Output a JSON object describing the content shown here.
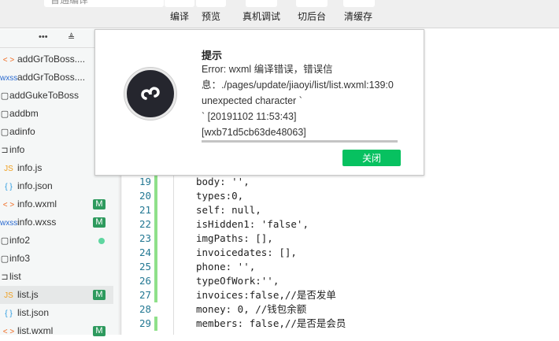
{
  "toolbar": {
    "compile_mode": "普通编译",
    "buttons": [
      "编译",
      "预览",
      "真机调试",
      "切后台",
      "清缓存"
    ]
  },
  "sidebar": {
    "more": "•••",
    "collapse": "≜",
    "items": [
      {
        "icon": "< >",
        "name": "addGrToBoss....",
        "badge": ""
      },
      {
        "icon": "wxss",
        "name": "addGrToBoss....",
        "badge": ""
      },
      {
        "icon": "folder",
        "name": "addGukeToBoss",
        "badge": ""
      },
      {
        "icon": "folder",
        "name": "addbm",
        "badge": ""
      },
      {
        "icon": "folder",
        "name": "adinfo",
        "badge": ""
      },
      {
        "icon": "folder-open",
        "name": "info",
        "badge": ""
      },
      {
        "icon": "JS",
        "name": "info.js",
        "badge": ""
      },
      {
        "icon": "{ }",
        "name": "info.json",
        "badge": ""
      },
      {
        "icon": "< >",
        "name": "info.wxml",
        "badge": "M"
      },
      {
        "icon": "wxss",
        "name": "info.wxss",
        "badge": "M"
      },
      {
        "icon": "folder",
        "name": "info2",
        "badge": "dot"
      },
      {
        "icon": "folder",
        "name": "info3",
        "badge": ""
      },
      {
        "icon": "folder-open",
        "name": "list",
        "badge": ""
      },
      {
        "icon": "JS",
        "name": "list.js",
        "badge": "M"
      },
      {
        "icon": "{ }",
        "name": "list.json",
        "badge": ""
      },
      {
        "icon": "< >",
        "name": "list.wxml",
        "badge": "M"
      }
    ]
  },
  "editor": {
    "lines": [
      {
        "n": "19",
        "code": "body: '',"
      },
      {
        "n": "20",
        "code": "types:0,"
      },
      {
        "n": "21",
        "code": "self: null,"
      },
      {
        "n": "22",
        "code": "isHidden1: 'false',"
      },
      {
        "n": "23",
        "code": "imgPaths: [],"
      },
      {
        "n": "24",
        "code": "invoicedates: [],"
      },
      {
        "n": "25",
        "code": "phone: '',"
      },
      {
        "n": "26",
        "code": "typeOfWork:'',"
      },
      {
        "n": "27",
        "code": "invoices:false,//是否发单"
      },
      {
        "n": "28",
        "code": "money: 0, //钱包余额"
      },
      {
        "n": "29",
        "code": "members: false,//是否是会员"
      }
    ]
  },
  "dialog": {
    "title": "提示",
    "lines": [
      "Error: wxml 编译错误，错误信",
      "息：./pages/update/jiaoyi/list/list.wxml:139:0",
      "unexpected character `",
      "` [20191102 11:53:43]",
      "[wxb71d5cb63de48063]"
    ],
    "close_label": "关闭"
  }
}
